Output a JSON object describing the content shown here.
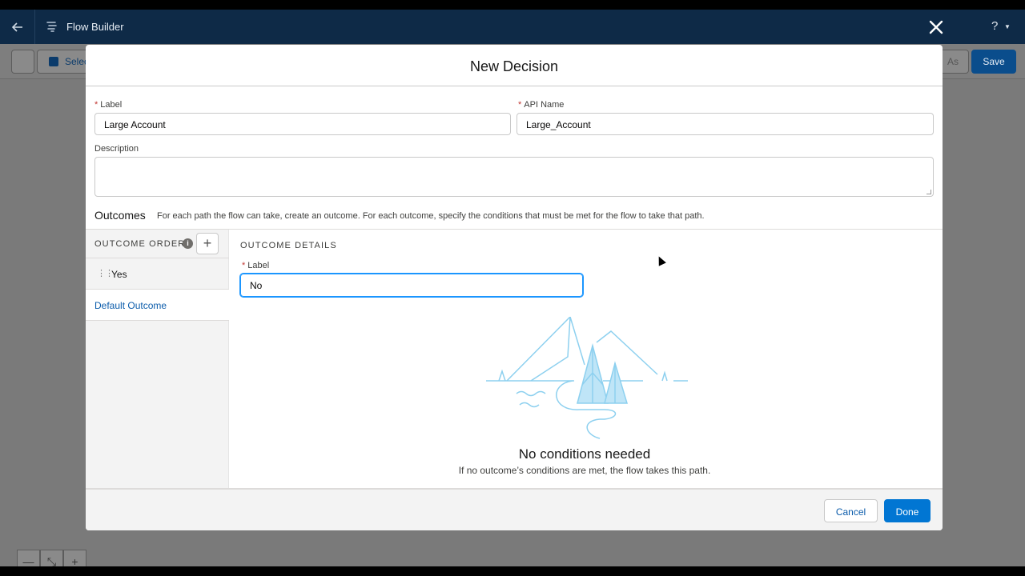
{
  "app": {
    "title": "Flow Builder",
    "help_label": "?"
  },
  "toolbar": {
    "select_label": "Selec",
    "save_as_label": "As",
    "save_label": "Save"
  },
  "modal": {
    "title": "New Decision",
    "label_field": {
      "label": "Label",
      "value": "Large Account"
    },
    "api_field": {
      "label": "API Name",
      "value": "Large_Account"
    },
    "description": {
      "label": "Description",
      "value": ""
    },
    "outcomes": {
      "title": "Outcomes",
      "description": "For each path the flow can take, create an outcome. For each outcome, specify the conditions that must be met for the flow to take that path."
    },
    "outcome_order": {
      "header": "OUTCOME ORDER",
      "info_glyph": "i",
      "add_glyph": "+",
      "items": [
        {
          "label": "Yes"
        },
        {
          "label": "Default Outcome"
        }
      ]
    },
    "outcome_details": {
      "header": "OUTCOME DETAILS",
      "label": "Label",
      "value": "No",
      "empty_title": "No conditions needed",
      "empty_subtitle": "If no outcome’s conditions are met, the flow takes this path."
    },
    "footer": {
      "cancel_label": "Cancel",
      "done_label": "Done"
    }
  },
  "canvas": {
    "zoom_out": "—",
    "fit": "⤡",
    "zoom_in": "+"
  },
  "colors": {
    "app_bar": "#0e2a47",
    "primary": "#0176d3",
    "link": "#0b5cab",
    "illustration": "#8dd0ef"
  }
}
